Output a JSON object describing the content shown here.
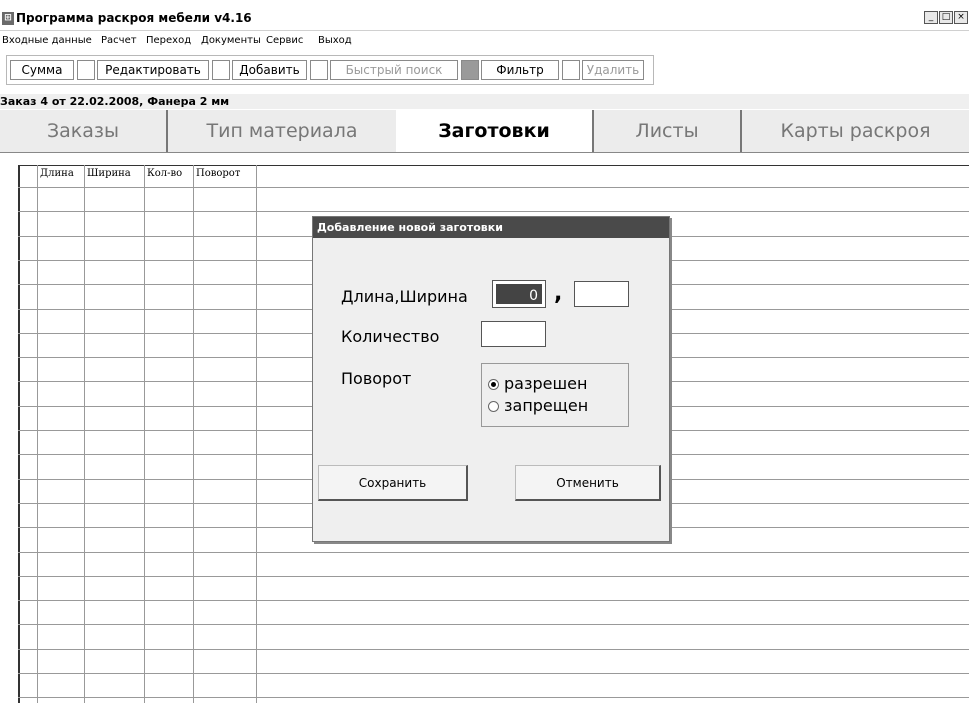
{
  "window": {
    "title": "Программа раскроя мебели v4.16",
    "icon": "app-icon",
    "controls": [
      "_",
      "□",
      "×"
    ]
  },
  "menu": [
    "Входные данные",
    "Расчет",
    "Переход",
    "Документы",
    "Сервис",
    "Выход"
  ],
  "toolbar": {
    "sum": "Сумма",
    "edit": "Редактировать",
    "add": "Добавить",
    "quick_search": "Быстрый поиск",
    "filter": "Фильтр",
    "delete": "Удалить"
  },
  "order_info": "Заказ 4 от 22.02.2008, Фанера  2 мм",
  "tabs": [
    {
      "label": "Заказы",
      "active": false
    },
    {
      "label": "Тип материала",
      "active": false
    },
    {
      "label": "Заготовки",
      "active": true
    },
    {
      "label": "Листы",
      "active": false
    },
    {
      "label": "Карты раскроя",
      "active": false
    }
  ],
  "grid": {
    "columns": [
      "Длина",
      "Ширина",
      "Кол-во",
      "Поворот"
    ]
  },
  "dialog": {
    "title": "Добавление новой заготовки",
    "length_width_label": "Длина,Ширина",
    "comma": ",",
    "length_value": "0",
    "width_value": "",
    "quantity_label": "Количество",
    "quantity_value": "",
    "rotation_label": "Поворот",
    "rotation_options": [
      {
        "label": "разрешен",
        "selected": true
      },
      {
        "label": "запрещен",
        "selected": false
      }
    ],
    "save": "Сохранить",
    "cancel": "Отменить"
  },
  "colors": {
    "dialog_title_bg": "#4a4a4a",
    "grid_line": "#999999",
    "tab_inactive_text": "#777777"
  }
}
